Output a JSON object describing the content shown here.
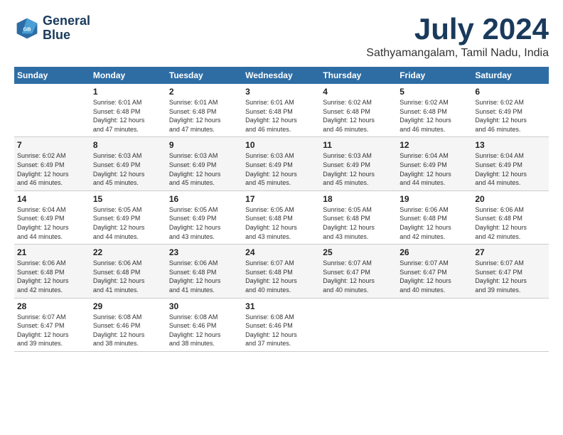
{
  "header": {
    "logo_line1": "General",
    "logo_line2": "Blue",
    "month_year": "July 2024",
    "location": "Sathyamangalam, Tamil Nadu, India"
  },
  "days_of_week": [
    "Sunday",
    "Monday",
    "Tuesday",
    "Wednesday",
    "Thursday",
    "Friday",
    "Saturday"
  ],
  "weeks": [
    [
      {
        "day": "",
        "content": ""
      },
      {
        "day": "1",
        "content": "Sunrise: 6:01 AM\nSunset: 6:48 PM\nDaylight: 12 hours\nand 47 minutes."
      },
      {
        "day": "2",
        "content": "Sunrise: 6:01 AM\nSunset: 6:48 PM\nDaylight: 12 hours\nand 47 minutes."
      },
      {
        "day": "3",
        "content": "Sunrise: 6:01 AM\nSunset: 6:48 PM\nDaylight: 12 hours\nand 46 minutes."
      },
      {
        "day": "4",
        "content": "Sunrise: 6:02 AM\nSunset: 6:48 PM\nDaylight: 12 hours\nand 46 minutes."
      },
      {
        "day": "5",
        "content": "Sunrise: 6:02 AM\nSunset: 6:48 PM\nDaylight: 12 hours\nand 46 minutes."
      },
      {
        "day": "6",
        "content": "Sunrise: 6:02 AM\nSunset: 6:49 PM\nDaylight: 12 hours\nand 46 minutes."
      }
    ],
    [
      {
        "day": "7",
        "content": "Sunrise: 6:02 AM\nSunset: 6:49 PM\nDaylight: 12 hours\nand 46 minutes."
      },
      {
        "day": "8",
        "content": "Sunrise: 6:03 AM\nSunset: 6:49 PM\nDaylight: 12 hours\nand 45 minutes."
      },
      {
        "day": "9",
        "content": "Sunrise: 6:03 AM\nSunset: 6:49 PM\nDaylight: 12 hours\nand 45 minutes."
      },
      {
        "day": "10",
        "content": "Sunrise: 6:03 AM\nSunset: 6:49 PM\nDaylight: 12 hours\nand 45 minutes."
      },
      {
        "day": "11",
        "content": "Sunrise: 6:03 AM\nSunset: 6:49 PM\nDaylight: 12 hours\nand 45 minutes."
      },
      {
        "day": "12",
        "content": "Sunrise: 6:04 AM\nSunset: 6:49 PM\nDaylight: 12 hours\nand 44 minutes."
      },
      {
        "day": "13",
        "content": "Sunrise: 6:04 AM\nSunset: 6:49 PM\nDaylight: 12 hours\nand 44 minutes."
      }
    ],
    [
      {
        "day": "14",
        "content": "Sunrise: 6:04 AM\nSunset: 6:49 PM\nDaylight: 12 hours\nand 44 minutes."
      },
      {
        "day": "15",
        "content": "Sunrise: 6:05 AM\nSunset: 6:49 PM\nDaylight: 12 hours\nand 44 minutes."
      },
      {
        "day": "16",
        "content": "Sunrise: 6:05 AM\nSunset: 6:49 PM\nDaylight: 12 hours\nand 43 minutes."
      },
      {
        "day": "17",
        "content": "Sunrise: 6:05 AM\nSunset: 6:48 PM\nDaylight: 12 hours\nand 43 minutes."
      },
      {
        "day": "18",
        "content": "Sunrise: 6:05 AM\nSunset: 6:48 PM\nDaylight: 12 hours\nand 43 minutes."
      },
      {
        "day": "19",
        "content": "Sunrise: 6:06 AM\nSunset: 6:48 PM\nDaylight: 12 hours\nand 42 minutes."
      },
      {
        "day": "20",
        "content": "Sunrise: 6:06 AM\nSunset: 6:48 PM\nDaylight: 12 hours\nand 42 minutes."
      }
    ],
    [
      {
        "day": "21",
        "content": "Sunrise: 6:06 AM\nSunset: 6:48 PM\nDaylight: 12 hours\nand 42 minutes."
      },
      {
        "day": "22",
        "content": "Sunrise: 6:06 AM\nSunset: 6:48 PM\nDaylight: 12 hours\nand 41 minutes."
      },
      {
        "day": "23",
        "content": "Sunrise: 6:06 AM\nSunset: 6:48 PM\nDaylight: 12 hours\nand 41 minutes."
      },
      {
        "day": "24",
        "content": "Sunrise: 6:07 AM\nSunset: 6:48 PM\nDaylight: 12 hours\nand 40 minutes."
      },
      {
        "day": "25",
        "content": "Sunrise: 6:07 AM\nSunset: 6:47 PM\nDaylight: 12 hours\nand 40 minutes."
      },
      {
        "day": "26",
        "content": "Sunrise: 6:07 AM\nSunset: 6:47 PM\nDaylight: 12 hours\nand 40 minutes."
      },
      {
        "day": "27",
        "content": "Sunrise: 6:07 AM\nSunset: 6:47 PM\nDaylight: 12 hours\nand 39 minutes."
      }
    ],
    [
      {
        "day": "28",
        "content": "Sunrise: 6:07 AM\nSunset: 6:47 PM\nDaylight: 12 hours\nand 39 minutes."
      },
      {
        "day": "29",
        "content": "Sunrise: 6:08 AM\nSunset: 6:46 PM\nDaylight: 12 hours\nand 38 minutes."
      },
      {
        "day": "30",
        "content": "Sunrise: 6:08 AM\nSunset: 6:46 PM\nDaylight: 12 hours\nand 38 minutes."
      },
      {
        "day": "31",
        "content": "Sunrise: 6:08 AM\nSunset: 6:46 PM\nDaylight: 12 hours\nand 37 minutes."
      },
      {
        "day": "",
        "content": ""
      },
      {
        "day": "",
        "content": ""
      },
      {
        "day": "",
        "content": ""
      }
    ]
  ]
}
